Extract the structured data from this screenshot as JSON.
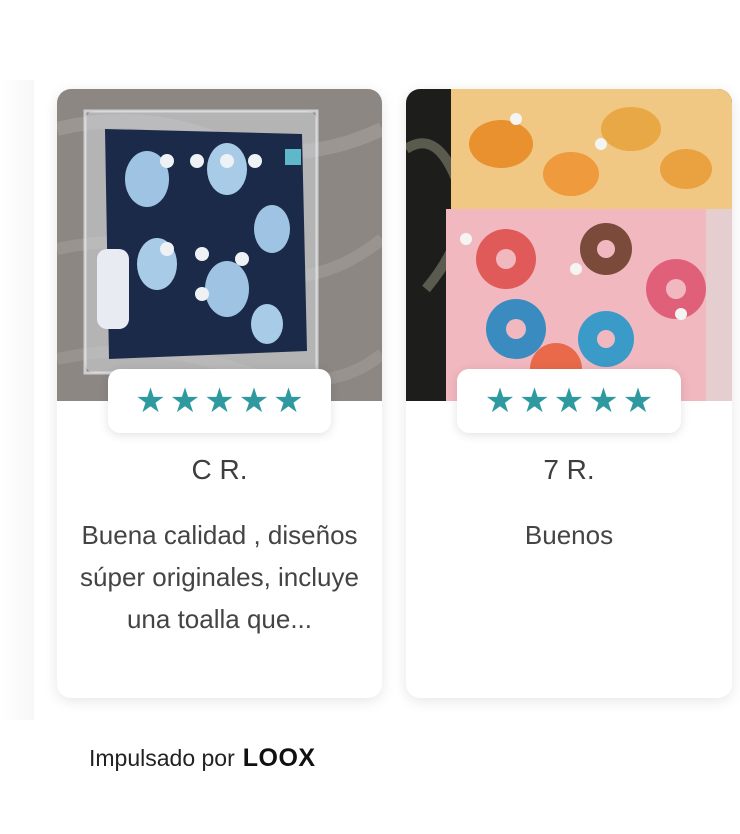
{
  "reviews": [
    {
      "author": "C R.",
      "text": "Buena calidad , diseños súper originales, incluye una toalla que...",
      "rating": 5,
      "photo_icon": "diaper-photo"
    },
    {
      "author": "7 R.",
      "text": "Buenos",
      "rating": 5,
      "photo_icon": "diaper-photo"
    }
  ],
  "stars": [
    "★",
    "★",
    "★",
    "★",
    "★"
  ],
  "colors": {
    "star": "#2e9aa0",
    "card_bg": "#ffffff"
  },
  "footer": {
    "powered_label": "Impulsado por",
    "brand": "LOOX"
  }
}
